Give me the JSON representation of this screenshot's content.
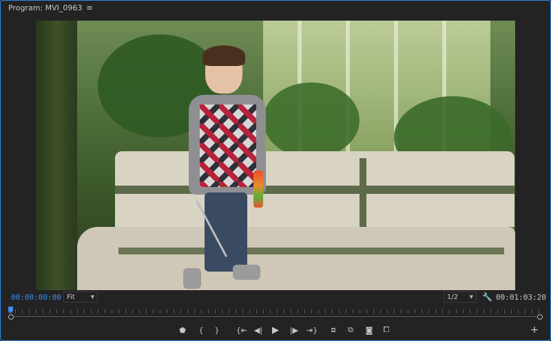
{
  "panel": {
    "title": "Program: MVI_0963",
    "menu_icon": "hamburger-icon"
  },
  "video": {
    "description_icon": "program-monitor-frame"
  },
  "controls": {
    "current_timecode": "00:00:00:00",
    "zoom_value": "Fit",
    "resolution_value": "1/2",
    "duration_timecode": "00:01:03:20",
    "settings_icon": "wrench-icon"
  },
  "scrubber": {
    "playhead_position": 0
  },
  "transport": {
    "buttons": [
      {
        "name": "add-marker-icon",
        "glyph": "⬟"
      },
      {
        "name": "mark-in-icon",
        "glyph": "{"
      },
      {
        "name": "mark-out-icon",
        "glyph": "}"
      },
      {
        "name": "go-to-in-icon",
        "glyph": "{⇤"
      },
      {
        "name": "step-back-icon",
        "glyph": "◀|"
      },
      {
        "name": "play-icon",
        "glyph": "▶"
      },
      {
        "name": "step-forward-icon",
        "glyph": "|▶"
      },
      {
        "name": "go-to-out-icon",
        "glyph": "⇥}"
      },
      {
        "name": "lift-icon",
        "glyph": "⧈"
      },
      {
        "name": "extract-icon",
        "glyph": "⧉"
      },
      {
        "name": "export-frame-icon",
        "glyph": "📷"
      },
      {
        "name": "comparison-view-icon",
        "glyph": "⧠"
      }
    ],
    "add_button_glyph": "+"
  }
}
